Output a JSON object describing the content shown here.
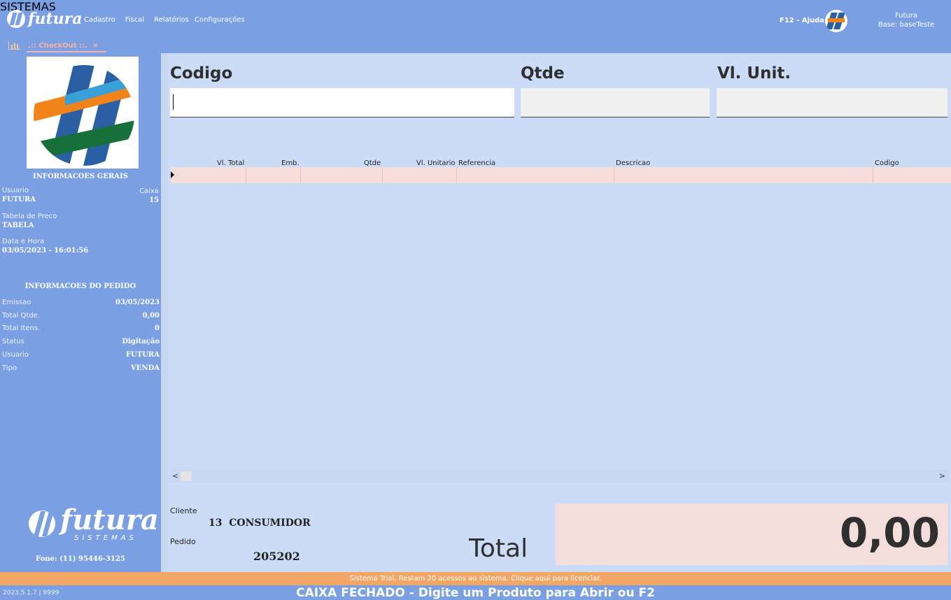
{
  "app": {
    "brand": "futura",
    "brand_sub": "SISTEMAS"
  },
  "menu": [
    "Cadastro",
    "Fiscal",
    "Relatórios",
    "Configurações"
  ],
  "header": {
    "help": "F12 - Ajuda",
    "user_name": "Futura",
    "base": "Base: baseTeste"
  },
  "tab": {
    "label": ".:: CheckOut ::.",
    "close": "×",
    "chart_icon": "bar-chart-icon"
  },
  "left": {
    "info_title": "INFORMACOES GERAIS",
    "usuario_label": "Usuario",
    "usuario": "FUTURA",
    "caixa_label": "Caixa",
    "caixa": "15",
    "tabela_label": "Tabela de Preco",
    "tabela": "TABELA",
    "datahora_label": "Data e Hora",
    "datahora": "03/05/2023 - 16:01:56",
    "pedido_title": "INFORMACOES DO PEDIDO",
    "rows": [
      {
        "label": "Emissao",
        "value": "03/05/2023"
      },
      {
        "label": "Total Qtde.",
        "value": "0,00"
      },
      {
        "label": "Total Itens.",
        "value": "0"
      },
      {
        "label": "Status",
        "value": "Digitação"
      },
      {
        "label": "Usuario",
        "value": "FUTURA"
      },
      {
        "label": "Tipo",
        "value": "VENDA"
      }
    ],
    "footer_brand": "futura",
    "footer_sub": "SISTEMAS",
    "phone": "Fone: (11) 95446-3125"
  },
  "entry": {
    "codigo": "Codigo",
    "qtde": "Qtde",
    "vlunit": "Vl. Unit.",
    "codigo_value": "",
    "qtde_value": "",
    "vlunit_value": ""
  },
  "grid": {
    "columns": [
      "Vl. Total",
      "Emb.",
      "Qtde",
      "Vl. Unitario",
      "Referencia",
      "Descricao",
      "Codigo"
    ]
  },
  "cliente": {
    "label": "Cliente",
    "value": "13  CONSUMIDOR"
  },
  "pedido": {
    "label": "Pedido",
    "value": "205202"
  },
  "total": {
    "label": "Total",
    "value": "0,00"
  },
  "trial": "Sistema Trial. Restam 20 acessos ao sistema. Clique aqui para licenciar.",
  "statusbar": {
    "version": "2023.5.1.7 | 9999",
    "message": "CAIXA FECHADO - Digite um Produto para Abrir ou F2"
  },
  "colors": {
    "primary": "#7a9fe2",
    "panel": "#ccdcf7",
    "trial": "#f2a767",
    "total_bg": "#f3dedb"
  }
}
